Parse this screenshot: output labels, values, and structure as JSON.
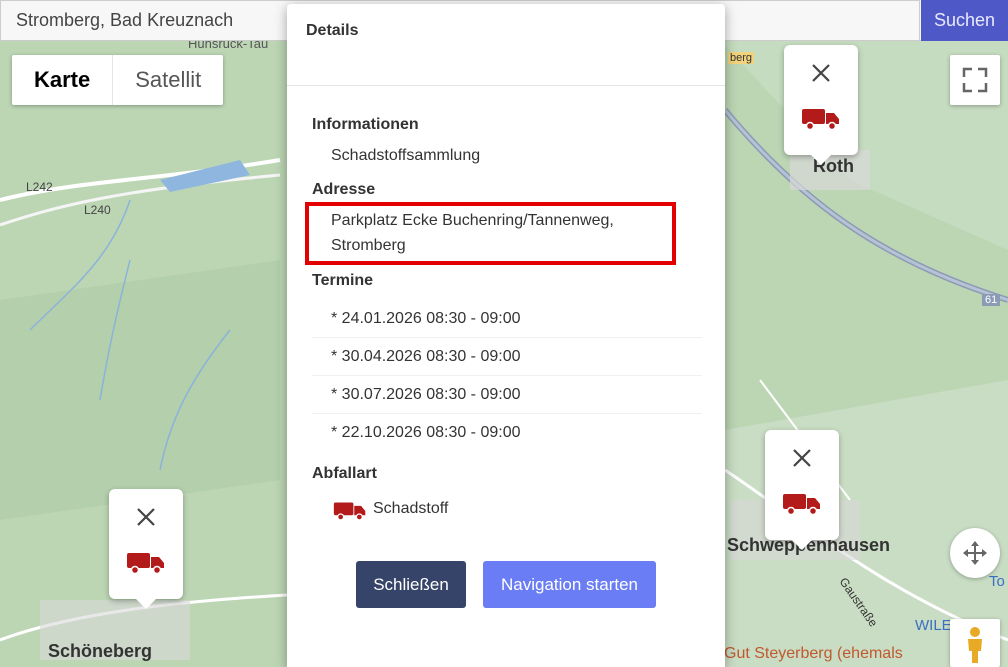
{
  "search": {
    "value": "Stromberg, Bad Kreuznach",
    "button_label": "Suchen"
  },
  "map_controls": {
    "maptype_map": "Karte",
    "maptype_satellite": "Satellit",
    "fullscreen_icon": "fullscreen-icon",
    "pan_icon": "pan-arrows-icon",
    "pegman_icon": "street-view-pegman-icon"
  },
  "map_labels": {
    "town_roth": "Roth",
    "town_schoeneberg": "Schöneberg",
    "town_schweppenhausen": "Schweppenhausen",
    "road_l242": "L242",
    "road_l240": "L240",
    "road_61": "61",
    "street_gaustrasse": "Gaustraße",
    "place_steyerberg": "Gut Steyerberg (ehemals",
    "place_hunsrueck": "Hunsrück-Tau",
    "place_wile": "WILE",
    "place_to": "To",
    "tag_stromberg": "berg"
  },
  "modal": {
    "title": "Details",
    "info_heading": "Informationen",
    "info_text": "Schadstoffsammlung",
    "address_heading": "Adresse",
    "address_line1": "Parkplatz Ecke Buchenring/Tannenweg,",
    "address_line2": "Stromberg",
    "dates_heading": "Termine",
    "dates": [
      "* 24.01.2026 08:30 - 09:00",
      "* 30.04.2026 08:30 - 09:00",
      "* 30.07.2026 08:30 - 09:00",
      "* 22.10.2026 08:30 - 09:00"
    ],
    "waste_heading": "Abfallart",
    "waste_type": "Schadstoff",
    "close_label": "Schließen",
    "navigation_label": "Navigation starten"
  },
  "colors": {
    "search_button": "#4e58c7",
    "close_button": "#374469",
    "navigation_button": "#6a7df5",
    "highlight_box": "#e30000",
    "truck_icon": "#b31b1b"
  }
}
